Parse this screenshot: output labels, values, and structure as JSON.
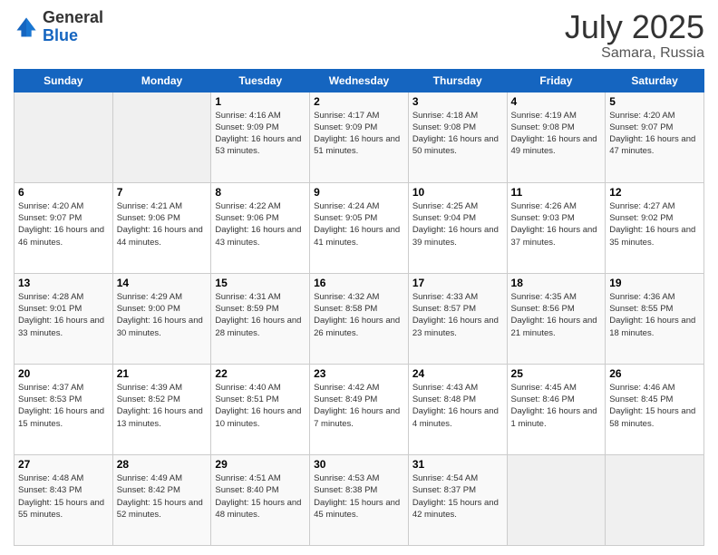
{
  "logo": {
    "general": "General",
    "blue": "Blue"
  },
  "title": {
    "month_year": "July 2025",
    "location": "Samara, Russia"
  },
  "days_of_week": [
    "Sunday",
    "Monday",
    "Tuesday",
    "Wednesday",
    "Thursday",
    "Friday",
    "Saturday"
  ],
  "weeks": [
    [
      {
        "day": "",
        "info": ""
      },
      {
        "day": "",
        "info": ""
      },
      {
        "day": "1",
        "info": "Sunrise: 4:16 AM\nSunset: 9:09 PM\nDaylight: 16 hours and 53 minutes."
      },
      {
        "day": "2",
        "info": "Sunrise: 4:17 AM\nSunset: 9:09 PM\nDaylight: 16 hours and 51 minutes."
      },
      {
        "day": "3",
        "info": "Sunrise: 4:18 AM\nSunset: 9:08 PM\nDaylight: 16 hours and 50 minutes."
      },
      {
        "day": "4",
        "info": "Sunrise: 4:19 AM\nSunset: 9:08 PM\nDaylight: 16 hours and 49 minutes."
      },
      {
        "day": "5",
        "info": "Sunrise: 4:20 AM\nSunset: 9:07 PM\nDaylight: 16 hours and 47 minutes."
      }
    ],
    [
      {
        "day": "6",
        "info": "Sunrise: 4:20 AM\nSunset: 9:07 PM\nDaylight: 16 hours and 46 minutes."
      },
      {
        "day": "7",
        "info": "Sunrise: 4:21 AM\nSunset: 9:06 PM\nDaylight: 16 hours and 44 minutes."
      },
      {
        "day": "8",
        "info": "Sunrise: 4:22 AM\nSunset: 9:06 PM\nDaylight: 16 hours and 43 minutes."
      },
      {
        "day": "9",
        "info": "Sunrise: 4:24 AM\nSunset: 9:05 PM\nDaylight: 16 hours and 41 minutes."
      },
      {
        "day": "10",
        "info": "Sunrise: 4:25 AM\nSunset: 9:04 PM\nDaylight: 16 hours and 39 minutes."
      },
      {
        "day": "11",
        "info": "Sunrise: 4:26 AM\nSunset: 9:03 PM\nDaylight: 16 hours and 37 minutes."
      },
      {
        "day": "12",
        "info": "Sunrise: 4:27 AM\nSunset: 9:02 PM\nDaylight: 16 hours and 35 minutes."
      }
    ],
    [
      {
        "day": "13",
        "info": "Sunrise: 4:28 AM\nSunset: 9:01 PM\nDaylight: 16 hours and 33 minutes."
      },
      {
        "day": "14",
        "info": "Sunrise: 4:29 AM\nSunset: 9:00 PM\nDaylight: 16 hours and 30 minutes."
      },
      {
        "day": "15",
        "info": "Sunrise: 4:31 AM\nSunset: 8:59 PM\nDaylight: 16 hours and 28 minutes."
      },
      {
        "day": "16",
        "info": "Sunrise: 4:32 AM\nSunset: 8:58 PM\nDaylight: 16 hours and 26 minutes."
      },
      {
        "day": "17",
        "info": "Sunrise: 4:33 AM\nSunset: 8:57 PM\nDaylight: 16 hours and 23 minutes."
      },
      {
        "day": "18",
        "info": "Sunrise: 4:35 AM\nSunset: 8:56 PM\nDaylight: 16 hours and 21 minutes."
      },
      {
        "day": "19",
        "info": "Sunrise: 4:36 AM\nSunset: 8:55 PM\nDaylight: 16 hours and 18 minutes."
      }
    ],
    [
      {
        "day": "20",
        "info": "Sunrise: 4:37 AM\nSunset: 8:53 PM\nDaylight: 16 hours and 15 minutes."
      },
      {
        "day": "21",
        "info": "Sunrise: 4:39 AM\nSunset: 8:52 PM\nDaylight: 16 hours and 13 minutes."
      },
      {
        "day": "22",
        "info": "Sunrise: 4:40 AM\nSunset: 8:51 PM\nDaylight: 16 hours and 10 minutes."
      },
      {
        "day": "23",
        "info": "Sunrise: 4:42 AM\nSunset: 8:49 PM\nDaylight: 16 hours and 7 minutes."
      },
      {
        "day": "24",
        "info": "Sunrise: 4:43 AM\nSunset: 8:48 PM\nDaylight: 16 hours and 4 minutes."
      },
      {
        "day": "25",
        "info": "Sunrise: 4:45 AM\nSunset: 8:46 PM\nDaylight: 16 hours and 1 minute."
      },
      {
        "day": "26",
        "info": "Sunrise: 4:46 AM\nSunset: 8:45 PM\nDaylight: 15 hours and 58 minutes."
      }
    ],
    [
      {
        "day": "27",
        "info": "Sunrise: 4:48 AM\nSunset: 8:43 PM\nDaylight: 15 hours and 55 minutes."
      },
      {
        "day": "28",
        "info": "Sunrise: 4:49 AM\nSunset: 8:42 PM\nDaylight: 15 hours and 52 minutes."
      },
      {
        "day": "29",
        "info": "Sunrise: 4:51 AM\nSunset: 8:40 PM\nDaylight: 15 hours and 48 minutes."
      },
      {
        "day": "30",
        "info": "Sunrise: 4:53 AM\nSunset: 8:38 PM\nDaylight: 15 hours and 45 minutes."
      },
      {
        "day": "31",
        "info": "Sunrise: 4:54 AM\nSunset: 8:37 PM\nDaylight: 15 hours and 42 minutes."
      },
      {
        "day": "",
        "info": ""
      },
      {
        "day": "",
        "info": ""
      }
    ]
  ]
}
